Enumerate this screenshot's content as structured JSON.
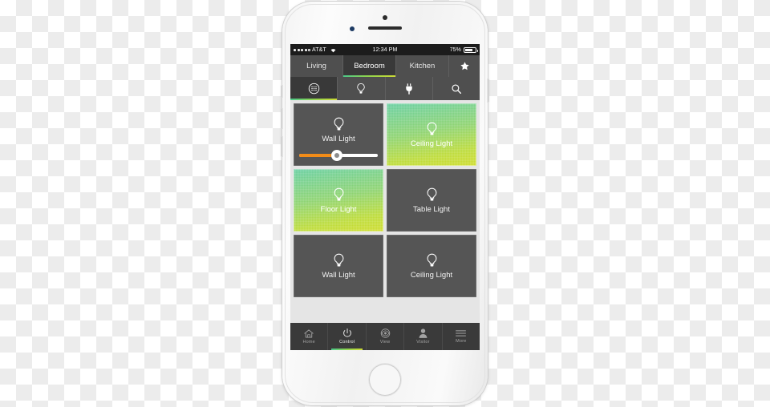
{
  "status_bar": {
    "carrier": "AT&T",
    "signal_dots": 5,
    "signal_filled": 4,
    "wifi_icon": "wifi-icon",
    "time": "12:34 PM",
    "battery_percent": "75%",
    "battery_level": 75
  },
  "room_tabs": [
    {
      "label": "Living",
      "active": false,
      "name": "room-tab-living"
    },
    {
      "label": "Bedroom",
      "active": true,
      "name": "room-tab-bedroom"
    },
    {
      "label": "Kitchen",
      "active": false,
      "name": "room-tab-kitchen"
    }
  ],
  "favorites_tab": {
    "icon": "star-icon",
    "name": "room-tab-favorites"
  },
  "category_tabs": [
    {
      "icon": "grid-circle-icon",
      "active": true,
      "name": "category-tab-all"
    },
    {
      "icon": "lightbulb-icon",
      "active": false,
      "name": "category-tab-lights"
    },
    {
      "icon": "power-plug-icon",
      "active": false,
      "name": "category-tab-outlets"
    },
    {
      "icon": "search-icon",
      "active": false,
      "name": "category-tab-search"
    }
  ],
  "tiles": [
    {
      "label": "Wall Light",
      "state": "off",
      "icon": "lightbulb-icon",
      "has_slider": true,
      "slider_value": 48
    },
    {
      "label": "Ceiling Light",
      "state": "on",
      "icon": "lightbulb-icon",
      "has_slider": false
    },
    {
      "label": "Floor Light",
      "state": "on",
      "icon": "lightbulb-icon",
      "has_slider": false
    },
    {
      "label": "Table Light",
      "state": "off",
      "icon": "lightbulb-icon",
      "has_slider": false
    },
    {
      "label": "Wall Light",
      "state": "off",
      "icon": "lightbulb-icon",
      "has_slider": false
    },
    {
      "label": "Ceiling Light",
      "state": "off",
      "icon": "lightbulb-icon",
      "has_slider": false
    }
  ],
  "bottom_tabs": [
    {
      "label": "Home",
      "icon": "home-icon",
      "active": false,
      "name": "bottom-tab-home"
    },
    {
      "label": "Control",
      "icon": "power-icon",
      "active": true,
      "name": "bottom-tab-control"
    },
    {
      "label": "View",
      "icon": "eye-icon",
      "active": false,
      "name": "bottom-tab-view"
    },
    {
      "label": "Visitor",
      "icon": "person-icon",
      "active": false,
      "name": "bottom-tab-visitor"
    },
    {
      "label": "More",
      "icon": "menu-icon",
      "active": false,
      "name": "bottom-tab-more"
    }
  ],
  "colors": {
    "tile_on_gradient_start": "#69cfa2",
    "tile_on_gradient_end": "#cfdd2e",
    "tile_off": "#555555",
    "slider_fill": "#f28c18",
    "accent_underline_start": "#4cc98a",
    "accent_underline_end": "#cddb35",
    "chrome_dark": "#3a3a3a",
    "chrome_mid": "#4f4f4f"
  }
}
